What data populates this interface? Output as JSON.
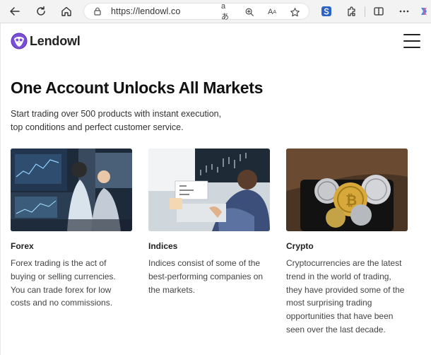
{
  "browser": {
    "url": "https://lendowl.co",
    "reader_icon": "read-aloud-icon",
    "text_size_label": "A"
  },
  "site": {
    "brand": "Lendowl",
    "accent": "#7b4fd6"
  },
  "hero": {
    "title": "One Account Unlocks All Markets",
    "subtitle_line1": "Start trading over 500 products with instant execution,",
    "subtitle_line2": "top conditions and perfect customer service."
  },
  "cards": [
    {
      "title": "Forex",
      "text": "Forex trading is the act of buying or selling currencies. You can trade forex for low costs and no commissions."
    },
    {
      "title": "Indices",
      "text": "Indices consist of some of the best-performing companies on the markets."
    },
    {
      "title": "Crypto",
      "text": "Cryptocurrencies are the latest trend in the world of trading, they have provided some of the most surprising trading opportunities that have been seen over the last decade."
    }
  ]
}
